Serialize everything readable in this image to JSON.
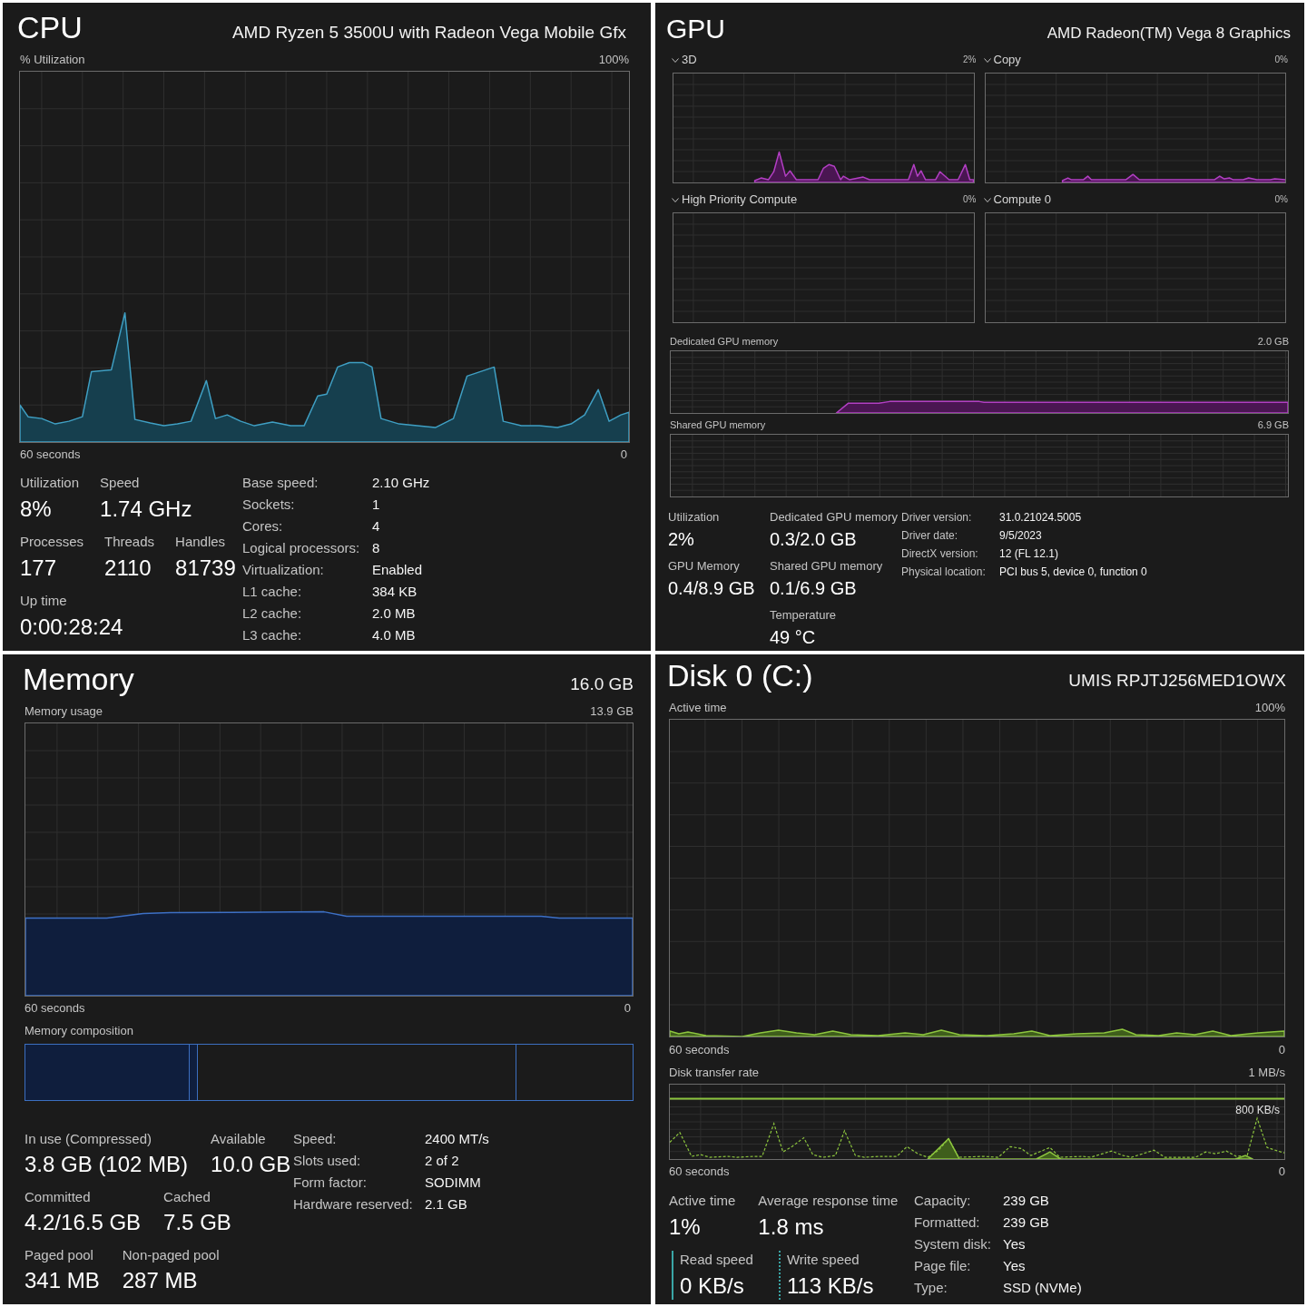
{
  "cpu": {
    "title": "CPU",
    "device": "AMD Ryzen 5 3500U with Radeon Vega Mobile Gfx",
    "graph": {
      "label": "% Utilization",
      "max": "100%",
      "time_window": "60 seconds",
      "time_end": "0"
    },
    "stat_rows": [
      [
        {
          "label": "Utilization",
          "value": "8%"
        },
        {
          "label": "Speed",
          "value": "1.74 GHz"
        }
      ],
      [
        {
          "label": "Processes",
          "value": "177"
        },
        {
          "label": "Threads",
          "value": "2110"
        },
        {
          "label": "Handles",
          "value": "81739"
        }
      ],
      [
        {
          "label": "Up time",
          "value": "0:00:28:24"
        }
      ]
    ],
    "details": [
      {
        "label": "Base speed:",
        "value": "2.10 GHz"
      },
      {
        "label": "Sockets:",
        "value": "1"
      },
      {
        "label": "Cores:",
        "value": "4"
      },
      {
        "label": "Logical processors:",
        "value": "8"
      },
      {
        "label": "Virtualization:",
        "value": "Enabled"
      },
      {
        "label": "L1 cache:",
        "value": "384 KB"
      },
      {
        "label": "L2 cache:",
        "value": "2.0 MB"
      },
      {
        "label": "L3 cache:",
        "value": "4.0 MB"
      }
    ]
  },
  "gpu": {
    "title": "GPU",
    "device": "AMD Radeon(TM) Vega 8 Graphics",
    "engines": [
      {
        "name": "3D",
        "reading": "2%"
      },
      {
        "name": "Copy",
        "reading": "0%"
      },
      {
        "name": "High Priority Compute",
        "reading": "0%"
      },
      {
        "name": "Compute 0",
        "reading": "0%"
      }
    ],
    "memory_graphs": [
      {
        "label": "Dedicated GPU memory",
        "max": "2.0 GB"
      },
      {
        "label": "Shared GPU memory",
        "max": "6.9 GB"
      }
    ],
    "stat_columns": [
      [
        {
          "label": "Utilization",
          "value": "2%"
        },
        {
          "label": "GPU Memory",
          "value": "0.4/8.9 GB"
        }
      ],
      [
        {
          "label": "Dedicated GPU memory",
          "value": "0.3/2.0 GB"
        },
        {
          "label": "Shared GPU memory",
          "value": "0.1/6.9 GB"
        },
        {
          "label": "Temperature",
          "value": "49 °C"
        }
      ]
    ],
    "details": [
      {
        "label": "Driver version:",
        "value": "31.0.21024.5005"
      },
      {
        "label": "Driver date:",
        "value": "9/5/2023"
      },
      {
        "label": "DirectX version:",
        "value": "12 (FL 12.1)"
      },
      {
        "label": "Physical location:",
        "value": "PCI bus 5, device 0, function 0"
      }
    ]
  },
  "memory": {
    "title": "Memory",
    "capacity": "16.0 GB",
    "graph": {
      "label": "Memory usage",
      "max": "13.9 GB",
      "time_window": "60 seconds",
      "time_end": "0"
    },
    "composition": {
      "label": "Memory composition",
      "segments": [
        {
          "kind": "filled",
          "level": 0.271
        },
        {
          "kind": "filled",
          "level": 0.284
        },
        {
          "kind": "outlined",
          "level": 0.809
        }
      ]
    },
    "stat_rows": [
      [
        {
          "label": "In use (Compressed)",
          "value": "3.8 GB (102 MB)"
        },
        {
          "label": "Available",
          "value": "10.0 GB"
        }
      ],
      [
        {
          "label": "Committed",
          "value": "4.2/16.5 GB"
        },
        {
          "label": "Cached",
          "value": "7.5 GB"
        }
      ],
      [
        {
          "label": "Paged pool",
          "value": "341 MB"
        },
        {
          "label": "Non-paged pool",
          "value": "287 MB"
        }
      ]
    ],
    "details": [
      {
        "label": "Speed:",
        "value": "2400 MT/s"
      },
      {
        "label": "Slots used:",
        "value": "2 of 2"
      },
      {
        "label": "Form factor:",
        "value": "SODIMM"
      },
      {
        "label": "Hardware reserved:",
        "value": "2.1 GB"
      }
    ]
  },
  "disk": {
    "title": "Disk 0 (C:)",
    "device": "UMIS RPJTJ256MED1OWX",
    "graphs": [
      {
        "label": "Active time",
        "max": "100%",
        "time_window": "60 seconds",
        "time_end": "0"
      },
      {
        "label": "Disk transfer rate",
        "max": "1 MB/s",
        "marker": "800 KB/s",
        "time_window": "60 seconds",
        "time_end": "0"
      }
    ],
    "stat_rows": [
      [
        {
          "kind": "plain",
          "label": "Active time",
          "value": "1%"
        },
        {
          "kind": "plain",
          "label": "Average response time",
          "value": "1.8 ms"
        }
      ],
      [
        {
          "kind": "solid",
          "label": "Read speed",
          "value": "0 KB/s"
        },
        {
          "kind": "dotted",
          "label": "Write speed",
          "value": "113 KB/s"
        }
      ]
    ],
    "details": [
      {
        "label": "Capacity:",
        "value": "239 GB"
      },
      {
        "label": "Formatted:",
        "value": "239 GB"
      },
      {
        "label": "System disk:",
        "value": "Yes"
      },
      {
        "label": "Page file:",
        "value": "Yes"
      },
      {
        "label": "Type:",
        "value": "SSD (NVMe)"
      }
    ]
  }
}
